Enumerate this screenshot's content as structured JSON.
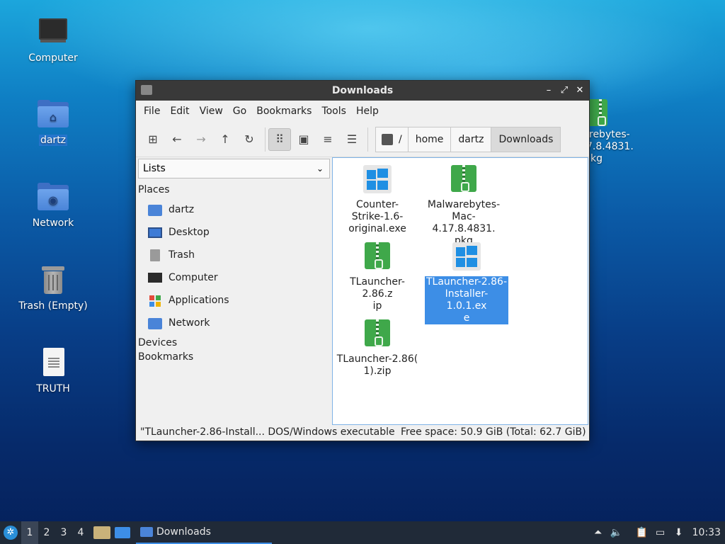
{
  "desktop": {
    "icons": [
      {
        "label": "Computer",
        "icon": "computer-icon"
      },
      {
        "label": "dartz",
        "icon": "home-folder-icon"
      },
      {
        "label": "Network",
        "icon": "network-folder-icon"
      },
      {
        "label": "Trash (Empty)",
        "icon": "trash-icon"
      },
      {
        "label": "TRUTH",
        "icon": "document-icon"
      }
    ],
    "partial_icon_label_lines": [
      "rebytes-",
      "7.8.4831.",
      "kg"
    ]
  },
  "window": {
    "title": "Downloads",
    "menu": [
      "File",
      "Edit",
      "View",
      "Go",
      "Bookmarks",
      "Tools",
      "Help"
    ],
    "path": {
      "root": "/",
      "crumbs": [
        "home",
        "dartz",
        "Downloads"
      ]
    },
    "side_panel": {
      "mode": "Lists",
      "places_header": "Places",
      "places": [
        {
          "label": "dartz",
          "icon": "home-folder-icon"
        },
        {
          "label": "Desktop",
          "icon": "desktop-icon"
        },
        {
          "label": "Trash",
          "icon": "trash-icon"
        },
        {
          "label": "Computer",
          "icon": "computer-icon"
        },
        {
          "label": "Applications",
          "icon": "applications-icon"
        },
        {
          "label": "Network",
          "icon": "network-folder-icon"
        }
      ],
      "devices_header": "Devices",
      "bookmarks_header": "Bookmarks"
    },
    "files": [
      {
        "lines": [
          "Counter-",
          "Strike-1.6-",
          "original.exe"
        ],
        "type": "exe"
      },
      {
        "lines": [
          "Malwarebytes-",
          "Mac-4.17.8.4831.",
          "pkg"
        ],
        "type": "zip"
      },
      {
        "lines": [
          "TLauncher-2.86.z",
          "ip"
        ],
        "type": "zip"
      },
      {
        "lines": [
          "TLauncher-2.86-",
          "Installer-1.0.1.ex",
          "e"
        ],
        "type": "exe",
        "selected": true
      },
      {
        "lines": [
          "TLauncher-2.86(",
          "1).zip"
        ],
        "type": "zip"
      }
    ],
    "status": {
      "selection": "\"TLauncher-2.86-Install... DOS/Windows executable",
      "free_space": "Free space: 50.9 GiB (Total: 62.7 GiB)"
    }
  },
  "taskbar": {
    "workspaces": [
      "1",
      "2",
      "3",
      "4"
    ],
    "active_workspace": "1",
    "task_label": "Downloads",
    "clock": "10:33"
  },
  "colors": {
    "selection": "#3d8ee6",
    "titlebar": "#393939",
    "taskbar": "#202a38",
    "zip_green": "#3fa84a",
    "windows_blue": "#1f8fe3"
  }
}
